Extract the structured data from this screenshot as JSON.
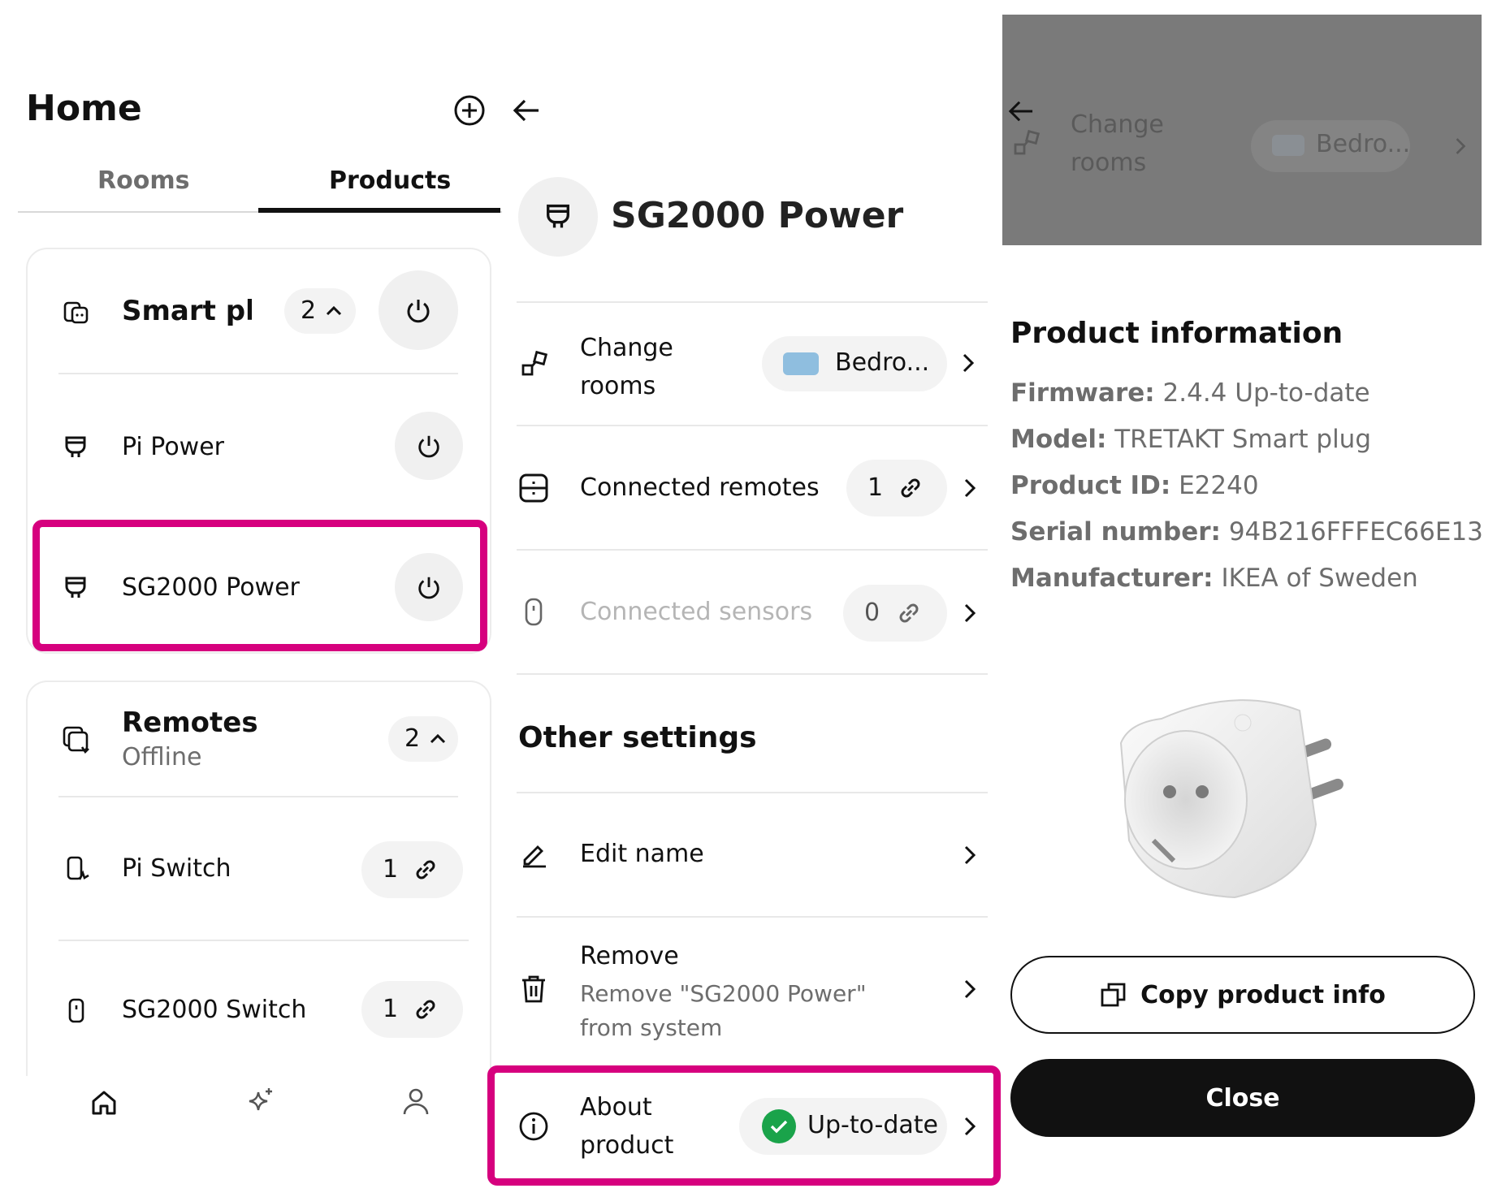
{
  "home": {
    "title": "Home",
    "tabs": [
      {
        "label": "Rooms",
        "active": false
      },
      {
        "label": "Products",
        "active": true
      }
    ],
    "smart_plugs": {
      "title": "Smart plu",
      "count": "2",
      "items": [
        {
          "name": "Pi Power"
        },
        {
          "name": "SG2000 Power"
        }
      ]
    },
    "remotes": {
      "title": "Remotes",
      "status": "Offline",
      "count": "2",
      "items": [
        {
          "name": "Pi Switch",
          "count": "1"
        },
        {
          "name": "SG2000 Switch",
          "count": "1"
        }
      ]
    },
    "bottom_nav": [
      "home-icon",
      "sparkle-icon",
      "profile-icon"
    ]
  },
  "detail": {
    "title": "SG2000 Power",
    "change_rooms": {
      "label": "Change rooms",
      "room": "Bedro...",
      "room_color": "#8fbedf"
    },
    "connected_remotes": {
      "label": "Connected remotes",
      "count": "1"
    },
    "connected_sensors": {
      "label": "Connected sensors",
      "count": "0"
    },
    "other_settings": "Other settings",
    "edit_name": "Edit name",
    "remove": {
      "title": "Remove",
      "subtitle": "Remove \"SG2000 Power\" from system"
    },
    "about": {
      "label": "About product",
      "status": "Up-to-date",
      "status_color": "#1aa34a"
    }
  },
  "info": {
    "overlay": {
      "change_rooms": "Change rooms",
      "room": "Bedro..."
    },
    "title": "Product information",
    "rows": [
      {
        "label": "Firmware:",
        "value": "2.4.4 Up-to-date"
      },
      {
        "label": "Model:",
        "value": "TRETAKT Smart plug"
      },
      {
        "label": "Product ID:",
        "value": "E2240"
      },
      {
        "label": "Serial number:",
        "value": "94B216FFFEC66E13"
      },
      {
        "label": "Manufacturer:",
        "value": "IKEA of Sweden"
      }
    ],
    "copy_button": "Copy product info",
    "close_button": "Close"
  },
  "colors": {
    "highlight": "#d6007e",
    "accent": "#111111",
    "success": "#1aa34a"
  }
}
